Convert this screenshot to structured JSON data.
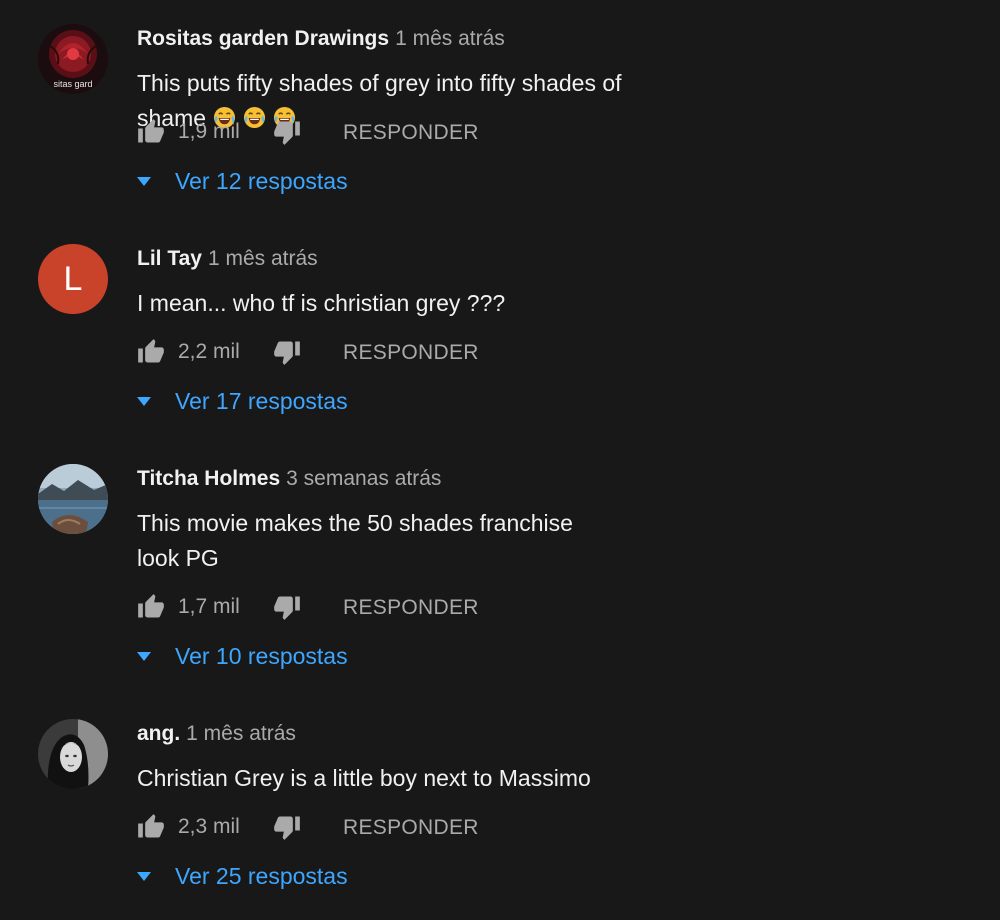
{
  "reply_label": "RESPONDER",
  "colors": {
    "background": "#181818",
    "text_primary": "#f1f1f1",
    "text_secondary": "#aaaaaa",
    "link": "#3ea6ff",
    "avatar_letter_bg": "#c9432a"
  },
  "icons": {
    "like": "thumbs-up-icon",
    "dislike": "thumbs-down-icon",
    "expand": "caret-down-icon",
    "emoji": "face-with-tears-of-joy-icon"
  },
  "comments": [
    {
      "author": "Rositas garden Drawings",
      "time": "1 mês atrás",
      "text": "This puts fifty shades of grey into fifty shades of shame",
      "emoji_count": 3,
      "likes": "1,9 mil",
      "replies": "Ver 12 respostas",
      "avatar_caption": "sitas gard"
    },
    {
      "author": "Lil Tay",
      "time": "1 mês atrás",
      "text": "I mean... who tf is christian grey ???",
      "likes": "2,2 mil",
      "replies": "Ver 17 respostas",
      "avatar_letter": "L"
    },
    {
      "author": "Titcha Holmes",
      "time": "3 semanas atrás",
      "text": "This movie makes the 50 shades franchise look  PG",
      "likes": "1,7 mil",
      "replies": "Ver 10 respostas"
    },
    {
      "author": "ang.",
      "time": "1 mês atrás",
      "text": "Christian Grey is a little boy next to Massimo",
      "likes": "2,3 mil",
      "replies": "Ver 25 respostas"
    }
  ]
}
